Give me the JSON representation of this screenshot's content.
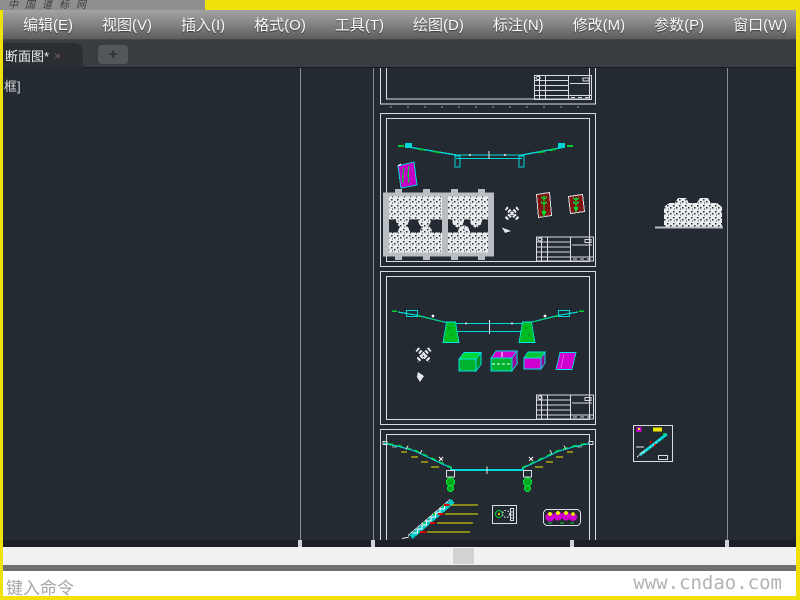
{
  "window": {
    "top_watermark": "中国道标网"
  },
  "menu_bar": {
    "items": [
      "编辑(E)",
      "视图(V)",
      "插入(I)",
      "格式(O)",
      "工具(T)",
      "绘图(D)",
      "标注(N)",
      "修改(M)",
      "参数(P)",
      "窗口(W)"
    ]
  },
  "tab_bar": {
    "active_tab": "断面图*",
    "close_glyph": "×",
    "new_tab_glyph": "+"
  },
  "canvas": {
    "overlay_text": "框]"
  },
  "command_bar": {
    "prompt": "键入命令"
  },
  "watermark": {
    "site": "www.cndao.com"
  },
  "colors": {
    "accent_yellow": "#f0e10a",
    "canvas_bg": "#242a32",
    "cad_cyan": "#00d7d7",
    "cad_green": "#00cc33",
    "cad_magenta": "#cf00cf",
    "cad_yellow": "#ece800",
    "cad_red": "#dd0000",
    "frame_white": "#d9dde2"
  }
}
